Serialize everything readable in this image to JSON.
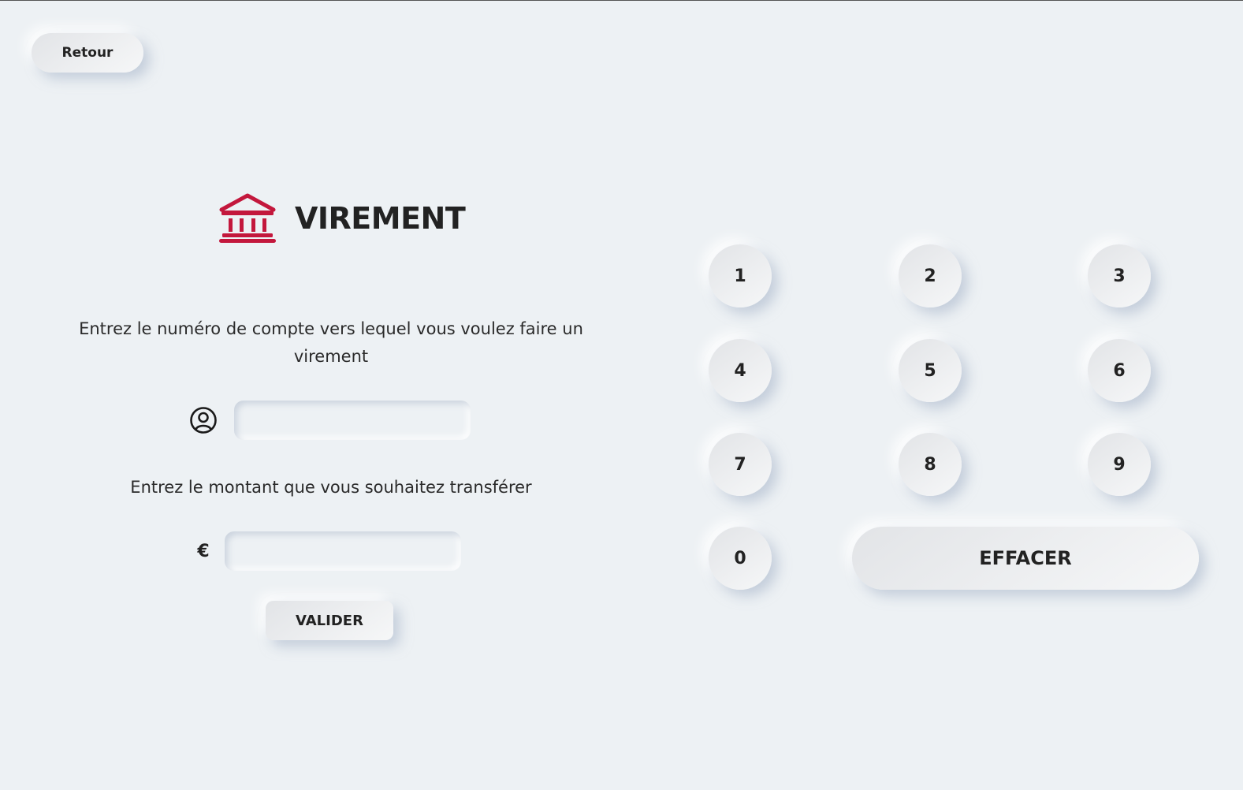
{
  "header": {
    "back_label": "Retour"
  },
  "transfer": {
    "title": "VIREMENT",
    "account_instruction": "Entrez le numéro de compte vers lequel vous voulez faire un virement",
    "account_value": "",
    "amount_instruction": "Entrez le montant que vous souhaitez transférer",
    "currency_symbol": "€",
    "amount_value": "",
    "validate_label": "VALIDER"
  },
  "keypad": {
    "keys": [
      "1",
      "2",
      "3",
      "4",
      "5",
      "6",
      "7",
      "8",
      "9",
      "0"
    ],
    "clear_label": "EFFACER"
  },
  "icons": {
    "title_icon": "bank-icon",
    "account_icon": "user-circle-icon"
  },
  "colors": {
    "background": "#edf1f4",
    "accent": "#c3173c",
    "text": "#222222"
  }
}
